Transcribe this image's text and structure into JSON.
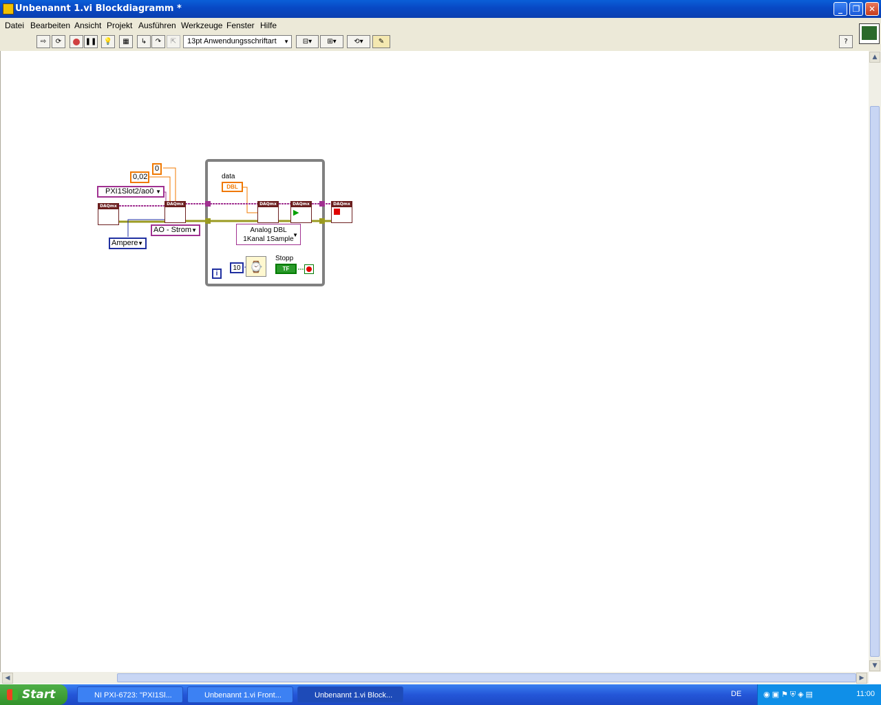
{
  "window": {
    "title": "Unbenannt 1.vi Blockdiagramm *",
    "buttons": {
      "minimize": "_",
      "maximize": "❐",
      "close": "✕"
    }
  },
  "menu": [
    "Datei",
    "Bearbeiten",
    "Ansicht",
    "Projekt",
    "Ausführen",
    "Werkzeuge",
    "Fenster",
    "Hilfe"
  ],
  "toolbar": {
    "font": "13pt Anwendungsschriftart",
    "help": "?"
  },
  "diagram": {
    "const_zero": "0",
    "const_002": "0,02",
    "channel": "PXI1Slot2/ao0",
    "measure": "AO - Strom",
    "units": "Ampere",
    "data_label": "data",
    "dbl_tag": "DBL",
    "poly_mode_line1": "Analog DBL",
    "poly_mode_line2": "1Kanal 1Sample",
    "wait_ms": "10",
    "stop_label": "Stopp",
    "tf_tag": "TF",
    "iter": "i",
    "daqmx": "DAQmx"
  },
  "taskbar": {
    "start": "Start",
    "tasks": [
      "NI PXI-6723: \"PXI1Sl...",
      "Unbenannt 1.vi Front...",
      "Unbenannt 1.vi Block..."
    ],
    "lang": "DE",
    "clock": "11:00"
  },
  "colors": {
    "titlebar": "#0848c4",
    "daqmx_wire": "#a03090",
    "error_wire": "#c8c800",
    "numeric": "#f07800",
    "int_blue": "#1f2fa0",
    "bool_green": "#007a00"
  }
}
